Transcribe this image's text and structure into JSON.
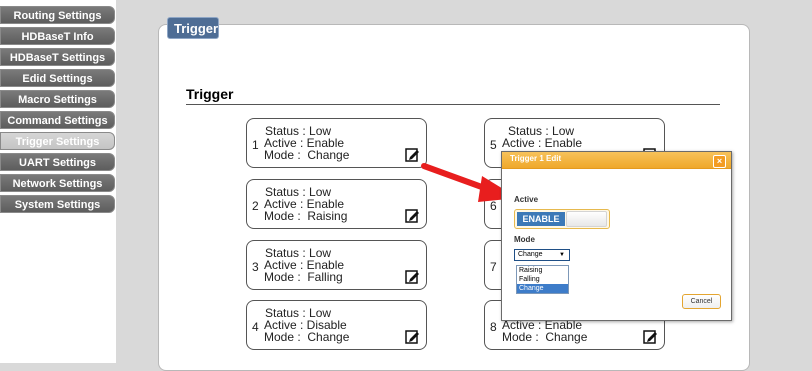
{
  "sidebar": {
    "items": [
      {
        "label": "Routing Settings"
      },
      {
        "label": "HDBaseT Info"
      },
      {
        "label": "HDBaseT Settings"
      },
      {
        "label": "Edid Settings"
      },
      {
        "label": "Macro Settings"
      },
      {
        "label": "Command Settings"
      },
      {
        "label": "Trigger Settings",
        "active": true
      },
      {
        "label": "UART Settings"
      },
      {
        "label": "Network Settings"
      },
      {
        "label": "System Settings"
      }
    ]
  },
  "panel": {
    "tab_label": "Trigger",
    "section_title": "Trigger"
  },
  "triggers": [
    {
      "num": "1",
      "status": "Status : Low",
      "active": "Active : Enable",
      "mode": "Mode :  Change"
    },
    {
      "num": "2",
      "status": "Status : Low",
      "active": "Active : Enable",
      "mode": "Mode :  Raising"
    },
    {
      "num": "3",
      "status": "Status : Low",
      "active": "Active : Enable",
      "mode": "Mode :  Falling"
    },
    {
      "num": "4",
      "status": "Status : Low",
      "active": "Active : Disable",
      "mode": "Mode :  Change"
    },
    {
      "num": "5",
      "status": "Status : Low",
      "active": "Active : Enable",
      "mode": ""
    },
    {
      "num": "6",
      "status": "",
      "active": "",
      "mode": ""
    },
    {
      "num": "7",
      "status": "",
      "active": "",
      "mode": ""
    },
    {
      "num": "8",
      "status": "",
      "active": "Active : Enable",
      "mode": "Mode :  Change"
    }
  ],
  "dialog": {
    "title": "Trigger 1 Edit",
    "close_glyph": "×",
    "active_label": "Active",
    "toggle_on_label": "ENABLE",
    "mode_label": "Mode",
    "mode_selected": "Change",
    "mode_options": [
      "Raising",
      "Falling",
      "Change"
    ],
    "cancel_label": "Cancel"
  },
  "colors": {
    "sidebar_bg": "#6a6a6a",
    "sidebar_active": "#cbcbcb",
    "tab_bg": "#4e6d95",
    "dialog_title": "#efa82b",
    "toggle_on": "#3c79b7",
    "arrow": "#e81e1e"
  },
  "icons": {
    "edit": "edit-icon",
    "arrow": "red-arrow-annotation",
    "close": "close-icon"
  }
}
